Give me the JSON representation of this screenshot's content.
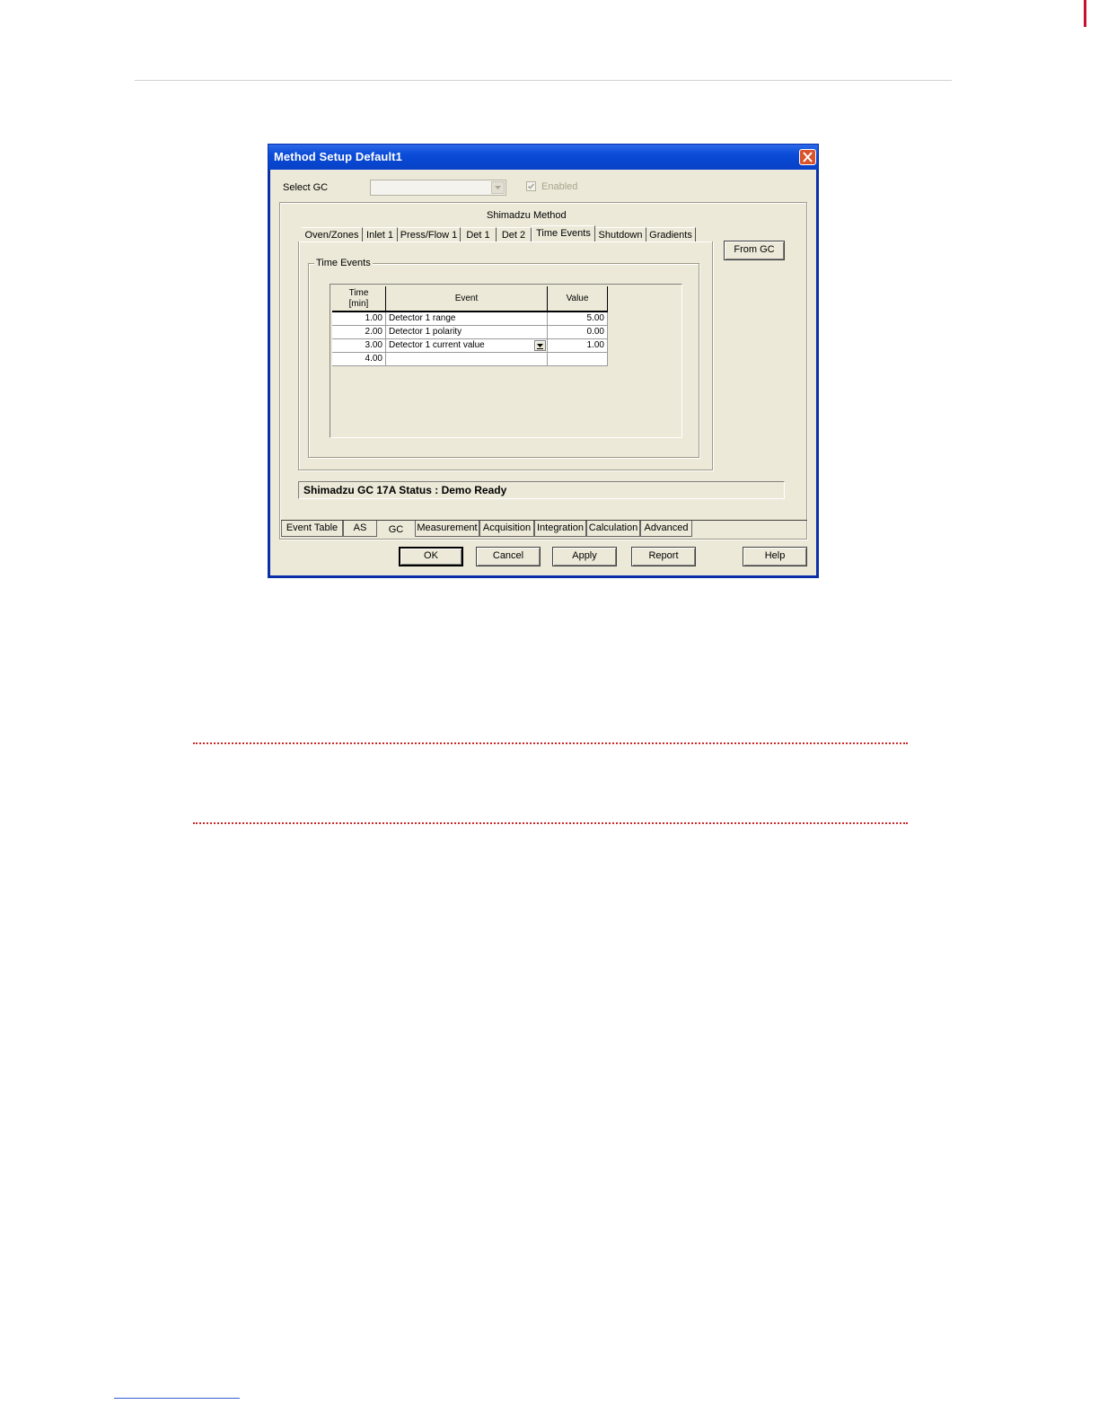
{
  "dialog": {
    "title": "Method Setup Default1",
    "select_gc_label": "Select GC",
    "select_gc_value": "",
    "enabled_label": "Enabled",
    "method_heading": "Shimadzu Method",
    "from_gc_button": "From GC",
    "status_text": "Shimadzu GC 17A Status : Demo Ready"
  },
  "method_tabs": [
    {
      "label": "Oven/Zones"
    },
    {
      "label": "Inlet 1"
    },
    {
      "label": "Press/Flow 1"
    },
    {
      "label": "Det 1"
    },
    {
      "label": "Det 2"
    },
    {
      "label": "Time Events",
      "active": true
    },
    {
      "label": "Shutdown"
    },
    {
      "label": "Gradients"
    }
  ],
  "time_events": {
    "group_label": "Time Events",
    "headers": {
      "time_line1": "Time",
      "time_line2": "[min]",
      "event": "Event",
      "value": "Value"
    },
    "rows": [
      {
        "time": "1.00",
        "event": "Detector 1 range",
        "value": "5.00"
      },
      {
        "time": "2.00",
        "event": "Detector 1 polarity",
        "value": "0.00"
      },
      {
        "time": "3.00",
        "event": "Detector 1 current value",
        "value": "1.00",
        "dropdown_open": true
      },
      {
        "time": "4.00",
        "event": "",
        "value": ""
      }
    ]
  },
  "bottom_tabs": [
    {
      "label": "Event Table"
    },
    {
      "label": "AS"
    },
    {
      "label": "GC",
      "active": true
    },
    {
      "label": "Measurement"
    },
    {
      "label": "Acquisition"
    },
    {
      "label": "Integration"
    },
    {
      "label": "Calculation"
    },
    {
      "label": "Advanced"
    }
  ],
  "buttons": {
    "ok": "OK",
    "cancel": "Cancel",
    "apply": "Apply",
    "report": "Report",
    "help": "Help"
  },
  "colors": {
    "title_bar": "#0a4bd8",
    "dialog_face": "#ece9d8",
    "close_button": "#d9532c",
    "dotted_rule": "#cc2a2a"
  }
}
